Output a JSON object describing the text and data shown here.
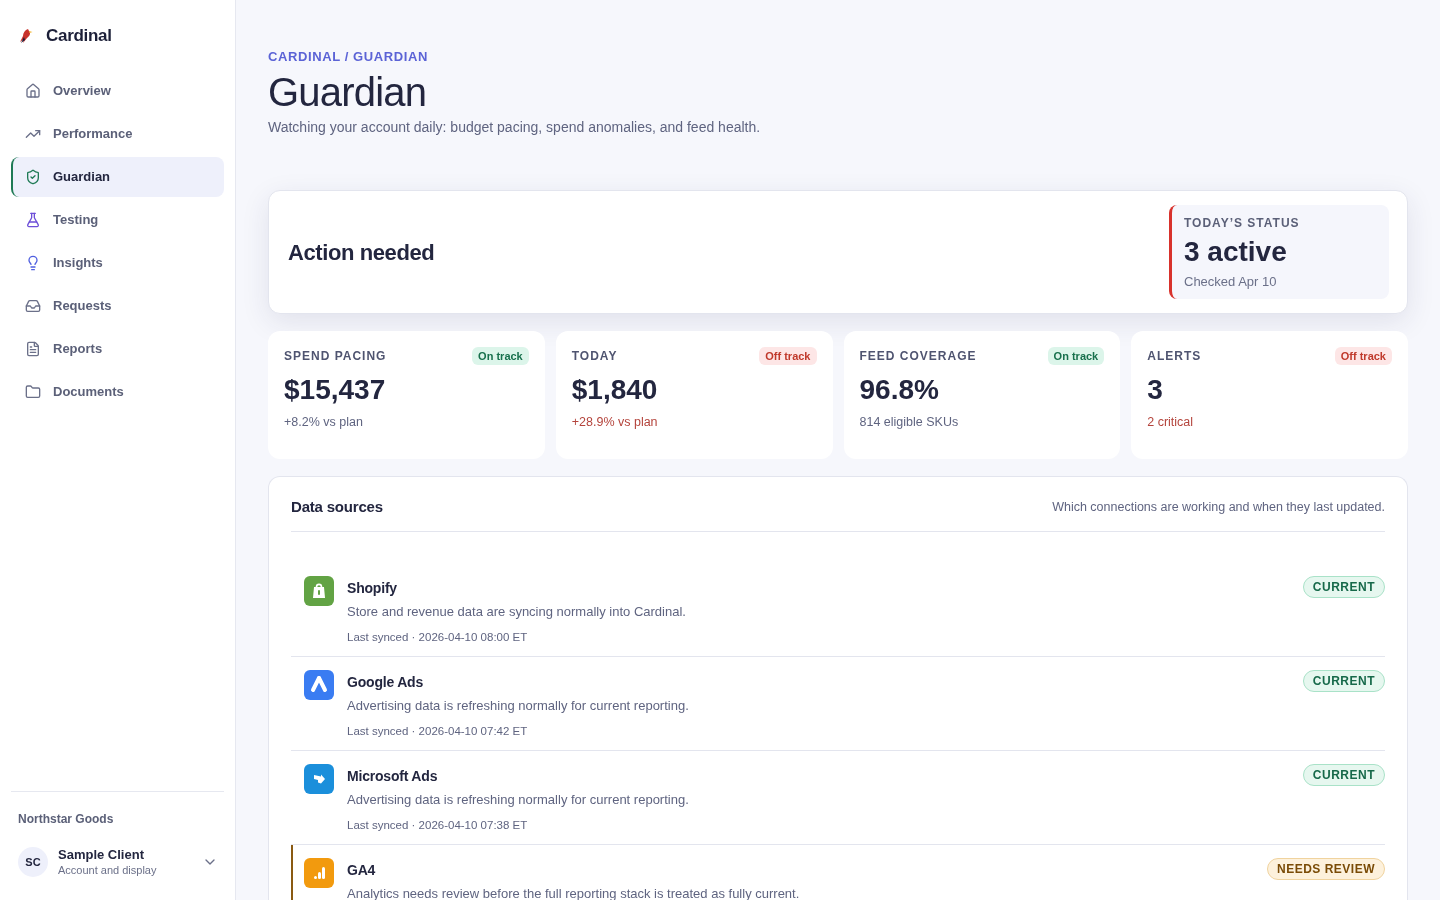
{
  "sidebar": {
    "brand": "Cardinal",
    "nav": [
      {
        "label": "Overview",
        "selected": false
      },
      {
        "label": "Performance",
        "selected": false
      },
      {
        "label": "Guardian",
        "selected": true
      },
      {
        "label": "Testing",
        "selected": false
      },
      {
        "label": "Insights",
        "selected": false
      },
      {
        "label": "Requests",
        "selected": false
      },
      {
        "label": "Reports",
        "selected": false
      },
      {
        "label": "Documents",
        "selected": false
      }
    ],
    "workspace": "Northstar Goods",
    "account": {
      "initials": "SC",
      "name": "Sample Client",
      "subtitle": "Account and display"
    }
  },
  "header": {
    "breadcrumb": "CARDINAL / GUARDIAN",
    "title": "Guardian",
    "subtitle": "Watching your account daily: budget pacing, spend anomalies, and feed health."
  },
  "action": {
    "title": "Action needed",
    "status": {
      "label": "TODAY’S STATUS",
      "value": "3 active",
      "checked": "Checked Apr 10"
    }
  },
  "metrics": [
    {
      "label": "SPEND PACING",
      "badge": "On track",
      "kind": "positive",
      "value": "$15,437",
      "note": "+8.2% vs plan"
    },
    {
      "label": "TODAY",
      "badge": "Off track",
      "kind": "negative",
      "value": "$1,840",
      "note": "+28.9% vs plan"
    },
    {
      "label": "FEED COVERAGE",
      "badge": "On track",
      "kind": "positive",
      "value": "96.8%",
      "note": "814 eligible SKUs"
    },
    {
      "label": "ALERTS",
      "badge": "Off track",
      "kind": "negative",
      "value": "3",
      "note": "2 critical"
    }
  ],
  "data_sources": {
    "title": "Data sources",
    "caption": "Which connections are working and when they last updated.",
    "sources": [
      {
        "name": "Shopify",
        "description": "Store and revenue data are syncing normally into Cardinal.",
        "synced": "Last synced · 2026-04-10 08:00 ET",
        "kind": "current",
        "badge": "CURRENT"
      },
      {
        "name": "Google Ads",
        "description": "Advertising data is refreshing normally for current reporting.",
        "synced": "Last synced · 2026-04-10 07:42 ET",
        "kind": "current",
        "badge": "CURRENT"
      },
      {
        "name": "Microsoft Ads",
        "description": "Advertising data is refreshing normally for current reporting.",
        "synced": "Last synced · 2026-04-10 07:38 ET",
        "kind": "current",
        "badge": "CURRENT"
      },
      {
        "name": "GA4",
        "description": "Analytics needs review before the full reporting stack is treated as fully current.",
        "kind": "review",
        "badge": "NEEDS REVIEW"
      }
    ]
  }
}
